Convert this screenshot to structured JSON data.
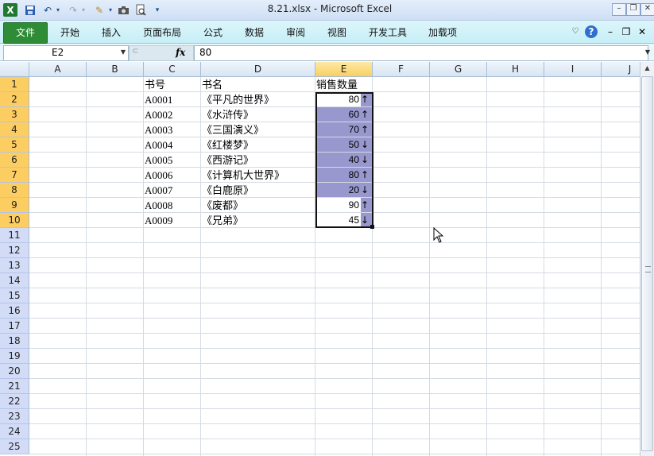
{
  "window": {
    "title": "8.21.xlsx - Microsoft Excel",
    "app_icon": "excel-icon",
    "quick_access": [
      "save-icon",
      "undo-icon",
      "redo-icon",
      "format-painter-icon",
      "camera-icon",
      "print-preview-icon",
      "customize-icon"
    ],
    "controls": [
      "minimize",
      "restore",
      "close"
    ]
  },
  "ribbon": {
    "tabs": [
      "文件",
      "开始",
      "插入",
      "页面布局",
      "公式",
      "数据",
      "审阅",
      "视图",
      "开发工具",
      "加载项"
    ],
    "active_tab": "文件",
    "right_icons": [
      "heart-icon",
      "help-icon",
      "minimize-ribbon-icon",
      "restore-workbook-icon",
      "close-workbook-icon"
    ]
  },
  "formula_bar": {
    "name_box": "E2",
    "fx_label": "fx",
    "value": "80"
  },
  "sheet": {
    "columns": [
      "A",
      "B",
      "C",
      "D",
      "E",
      "F",
      "G",
      "H",
      "I",
      "J"
    ],
    "selected_column": "E",
    "rows": [
      "1",
      "2",
      "3",
      "4",
      "5",
      "6",
      "7",
      "8",
      "9",
      "10",
      "11",
      "12",
      "13",
      "14",
      "15",
      "16",
      "17",
      "18",
      "19",
      "20",
      "21",
      "22",
      "23",
      "24",
      "25"
    ],
    "selected_rows": [
      "1",
      "2",
      "3",
      "4",
      "5",
      "6",
      "7",
      "8",
      "9",
      "10"
    ],
    "headers": {
      "c": "书号",
      "d": "书名",
      "e": "销售数量"
    },
    "records": [
      {
        "id": "A0001",
        "name": "《平凡的世界》",
        "qty": "80",
        "arrow": "↑"
      },
      {
        "id": "A0002",
        "name": "《水浒传》",
        "qty": "60",
        "arrow": "↑"
      },
      {
        "id": "A0003",
        "name": "《三国演义》",
        "qty": "70",
        "arrow": "↑"
      },
      {
        "id": "A0004",
        "name": "《红楼梦》",
        "qty": "50",
        "arrow": "↓"
      },
      {
        "id": "A0005",
        "name": "《西游记》",
        "qty": "40",
        "arrow": "↓"
      },
      {
        "id": "A0006",
        "name": "《计算机大世界》",
        "qty": "80",
        "arrow": "↑"
      },
      {
        "id": "A0007",
        "name": "《白鹿原》",
        "qty": "20",
        "arrow": "↓"
      },
      {
        "id": "A0008",
        "name": "《废都》",
        "qty": "90",
        "arrow": "↑"
      },
      {
        "id": "A0009",
        "name": "《兄弟》",
        "qty": "45",
        "arrow": "↓"
      }
    ],
    "highlight_color": "#9898ce",
    "selection_color": "#fccd61"
  }
}
